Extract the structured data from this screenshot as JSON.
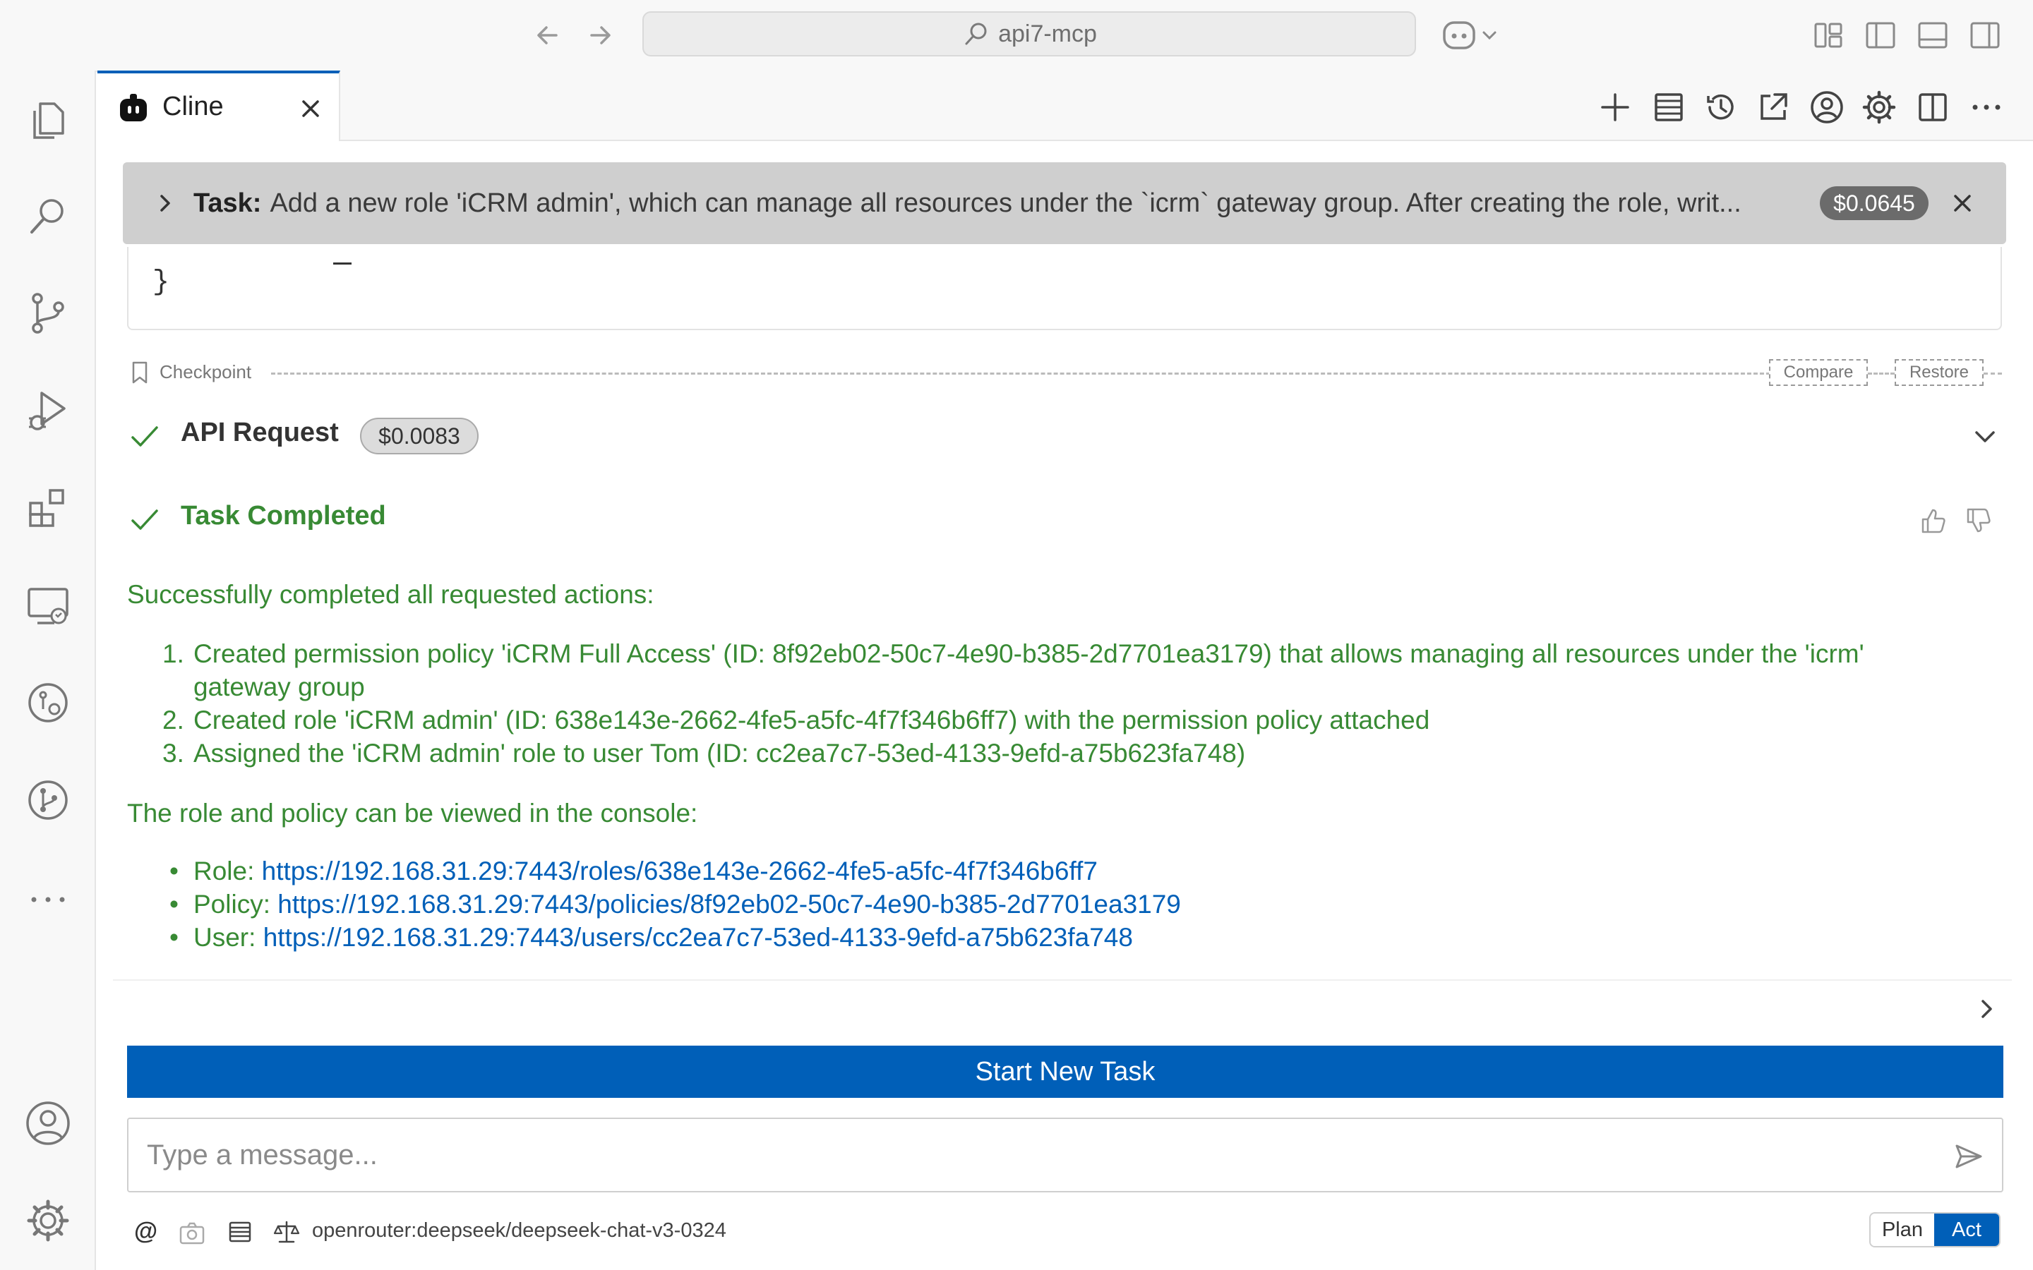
{
  "titlebar": {
    "search_text": "api7-mcp"
  },
  "tab": {
    "label": "Cline"
  },
  "task": {
    "prefix": "Task:",
    "text": "Add a new role 'iCRM admin', which can manage all resources under the `icrm` gateway group. After creating the role, writ...",
    "cost": "$0.0645"
  },
  "code": {
    "brace": "}"
  },
  "checkpoint": {
    "label": "Checkpoint",
    "compare": "Compare",
    "restore": "Restore"
  },
  "api_request": {
    "label": "API Request",
    "cost": "$0.0083"
  },
  "completion": {
    "title": "Task Completed",
    "intro": "Successfully completed all requested actions:",
    "steps": [
      {
        "num": "1.",
        "line1": "Created permission policy 'iCRM Full Access' (ID: 8f92eb02-50c7-4e90-b385-2d7701ea3179) that allows managing all resources under the 'icrm'",
        "line2": "gateway group"
      },
      {
        "num": "2.",
        "line1": "Created role 'iCRM admin' (ID: 638e143e-2662-4fe5-a5fc-4f7f346b6ff7) with the permission policy attached"
      },
      {
        "num": "3.",
        "line1": "Assigned the 'iCRM admin' role to user Tom (ID: cc2ea7c7-53ed-4133-9efd-a75b623fa748)"
      }
    ],
    "console_intro": "The role and policy can be viewed in the console:",
    "links": [
      {
        "label": "Role:",
        "url": "https://192.168.31.29:7443/roles/638e143e-2662-4fe5-a5fc-4f7f346b6ff7"
      },
      {
        "label": "Policy:",
        "url": "https://192.168.31.29:7443/policies/8f92eb02-50c7-4e90-b385-2d7701ea3179"
      },
      {
        "label": "User:",
        "url": "https://192.168.31.29:7443/users/cc2ea7c7-53ed-4133-9efd-a75b623fa748"
      }
    ]
  },
  "actions": {
    "start_new_task": "Start New Task"
  },
  "input": {
    "placeholder": "Type a message..."
  },
  "footer": {
    "at_symbol": "@",
    "model": "openrouter:deepseek/deepseek-chat-v3-0324",
    "mode_plan": "Plan",
    "mode_act": "Act"
  },
  "colors": {
    "accent": "#005fb8",
    "success": "#388a34",
    "banner": "#cfcfcf"
  }
}
